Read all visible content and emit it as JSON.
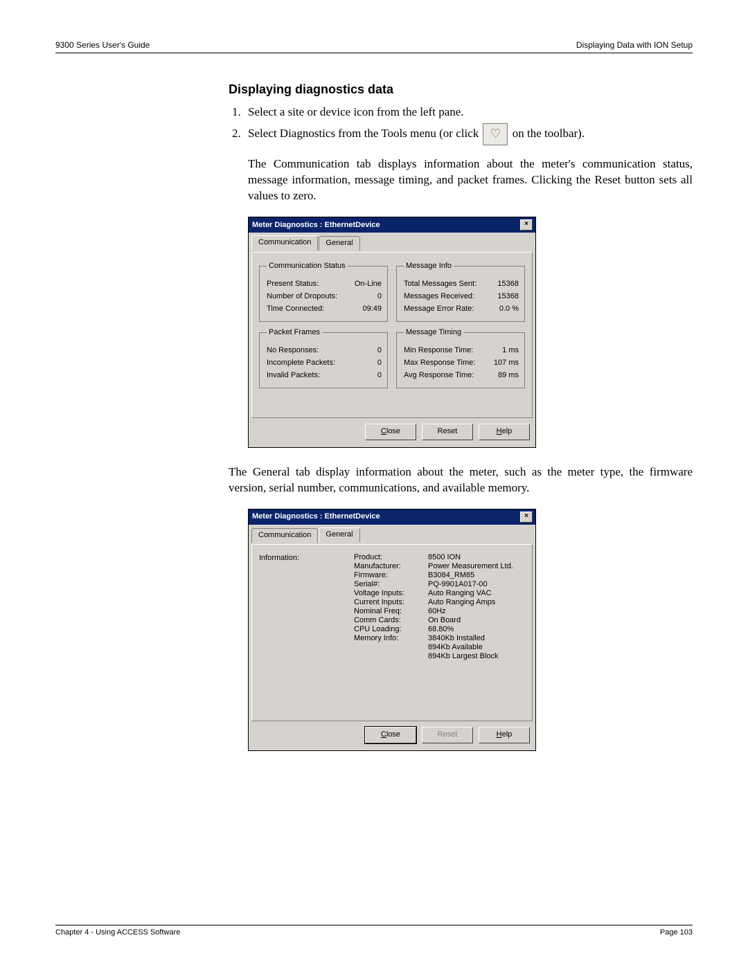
{
  "header": {
    "left": "9300 Series User's Guide",
    "right": "Displaying Data with ION Setup"
  },
  "section_title": "Displaying diagnostics data",
  "steps": {
    "s1": "Select a site or device icon from the left pane.",
    "s2a": "Select Diagnostics from the Tools menu (or click",
    "s2b": "on the toolbar).",
    "icon_glyph": "♡"
  },
  "para1": "The Communication tab displays information about the meter's communication status, message information, message timing, and packet frames. Clicking the Reset button sets all values to zero.",
  "para2": "The General tab display information about the meter, such as the meter type, the firmware version, serial number, communications, and available memory.",
  "dialog1": {
    "title": "Meter Diagnostics : EthernetDevice",
    "tab_comm": "Communication",
    "tab_gen": "General",
    "grp_comm_status": "Communication Status",
    "present_status_l": "Present Status:",
    "present_status_v": "On-Line",
    "dropouts_l": "Number of Dropouts:",
    "dropouts_v": "0",
    "time_conn_l": "Time Connected:",
    "time_conn_v": "09:49",
    "grp_packet": "Packet Frames",
    "noresp_l": "No Responses:",
    "noresp_v": "0",
    "incomp_l": "Incomplete Packets:",
    "incomp_v": "0",
    "invalid_l": "Invalid Packets:",
    "invalid_v": "0",
    "grp_msginfo": "Message Info",
    "sent_l": "Total Messages Sent:",
    "sent_v": "15368",
    "recv_l": "Messages Received:",
    "recv_v": "15368",
    "err_l": "Message Error Rate:",
    "err_v": "0.0 %",
    "grp_timing": "Message Timing",
    "min_l": "Min Response Time:",
    "min_v": "1  ms",
    "max_l": "Max Response Time:",
    "max_v": "107  ms",
    "avg_l": "Avg Response Time:",
    "avg_v": "89  ms",
    "btn_close": "Close",
    "btn_reset": "Reset",
    "btn_help": "Help"
  },
  "dialog2": {
    "title": "Meter Diagnostics : EthernetDevice",
    "tab_comm": "Communication",
    "tab_gen": "General",
    "info_label": "Information:",
    "left_lines": [
      "Product:",
      "Manufacturer:",
      "Firmware:",
      "Serial#:",
      "Voltage Inputs:",
      "Current Inputs:",
      "Nominal Freq:",
      "Comm Cards:",
      "CPU Loading:",
      "Memory Info:"
    ],
    "right_lines": [
      "8500 ION",
      "Power Measurement Ltd.",
      "B3084_RM85",
      "PQ-9901A017-00",
      "Auto Ranging VAC",
      "Auto Ranging Amps",
      "60Hz",
      "On Board",
      "68.80%",
      "3840Kb Installed",
      "894Kb Available",
      "894Kb Largest Block"
    ],
    "btn_close": "Close",
    "btn_reset": "Reset",
    "btn_help": "Help"
  },
  "footer": {
    "left": "Chapter 4 - Using ACCESS Software",
    "right": "Page 103"
  }
}
